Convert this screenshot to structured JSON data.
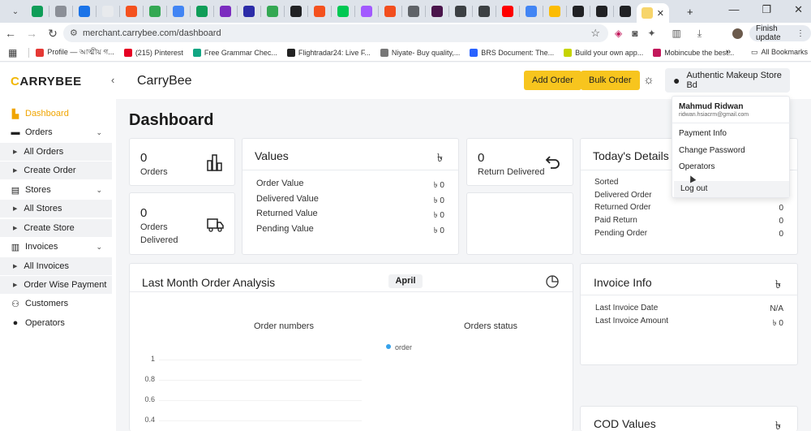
{
  "browser": {
    "tab_icon_colors": [
      "#0f9d58",
      "#8b8f97",
      "#1a73e8",
      "#e8eaed",
      "#f4511e",
      "#34a853",
      "#4285f4",
      "#0f9d58",
      "#7b2cbf",
      "#2c2ca8",
      "#34a853",
      "#202124",
      "#f4511e",
      "#00c853",
      "#a259ff",
      "#f24e1e",
      "#5f6368",
      "#4a154b",
      "#3c4043",
      "#3c4043",
      "#ff0000",
      "#4285f4",
      "#fbbc04",
      "#202124",
      "#202124",
      "#202124"
    ],
    "active_tab_icon_color": "#f7d56b",
    "new_tab_label": "+",
    "url": "merchant.carrybee.com/dashboard",
    "finish_update": "Finish update",
    "bookmarks": [
      {
        "label": "Profile — আত্মীয় গ...",
        "color": "#e53935"
      },
      {
        "label": "(215) Pinterest",
        "color": "#e60023"
      },
      {
        "label": "Free Grammar Chec...",
        "color": "#11a683"
      },
      {
        "label": "Flightradar24: Live F...",
        "color": "#222222"
      },
      {
        "label": "Niyate- Buy quality,...",
        "color": "#777777"
      },
      {
        "label": "BRS Document: The...",
        "color": "#2962ff"
      },
      {
        "label": "Build your own app...",
        "color": "#c6d400"
      },
      {
        "label": "Mobincube the best...",
        "color": "#c2185b"
      }
    ],
    "all_bookmarks": "All Bookmarks"
  },
  "header": {
    "logo_first": "C",
    "logo_rest": "ARRYBEE",
    "title": "CarryBee",
    "add_order": "Add Order",
    "bulk_order": "Bulk Order",
    "store_name": "Authentic Makeup Store Bd"
  },
  "sidebar": {
    "dashboard": "Dashboard",
    "orders": "Orders",
    "all_orders": "All Orders",
    "create_order": "Create Order",
    "stores": "Stores",
    "all_stores": "All Stores",
    "create_store": "Create Store",
    "invoices": "Invoices",
    "all_invoices": "All Invoices",
    "order_wise_payment": "Order Wise Payment",
    "customers": "Customers",
    "operators": "Operators"
  },
  "main": {
    "title": "Dashboard",
    "orders_count": "0",
    "orders_label": "Orders",
    "delivered_count": "0",
    "delivered_label_1": "Orders",
    "delivered_label_2": "Delivered",
    "values_title": "Values",
    "currency": "৳",
    "values": [
      {
        "label": "Order Value",
        "value": "৳ 0"
      },
      {
        "label": "Delivered Value",
        "value": "৳ 0"
      },
      {
        "label": "Returned Value",
        "value": "৳ 0"
      },
      {
        "label": "Pending Value",
        "value": "৳ 0"
      }
    ],
    "return_count": "0",
    "return_label": "Return Delivered",
    "today_title": "Today's Details",
    "today": [
      {
        "label": "Sorted",
        "value": ""
      },
      {
        "label": "Delivered Order",
        "value": ""
      },
      {
        "label": "Returned Order",
        "value": "0"
      },
      {
        "label": "Paid Return",
        "value": "0"
      },
      {
        "label": "Pending Order",
        "value": "0"
      }
    ],
    "analysis_title": "Last Month Order Analysis",
    "month": "April",
    "order_numbers": "Order numbers",
    "orders_status": "Orders status",
    "legend_order": "order",
    "y_ticks": [
      "1",
      "0.8",
      "0.6",
      "0.4"
    ],
    "invoice_title": "Invoice Info",
    "invoice": [
      {
        "label": "Last Invoice Date",
        "value": "N/A"
      },
      {
        "label": "Last Invoice Amount",
        "value": "৳ 0"
      }
    ],
    "cod_title": "COD Values"
  },
  "dropdown": {
    "name": "Mahmud Ridwan",
    "email": "ridwan.hsiacrm@gmail.com",
    "items": [
      "Payment Info",
      "Change Password",
      "Operators",
      "Log out"
    ]
  }
}
